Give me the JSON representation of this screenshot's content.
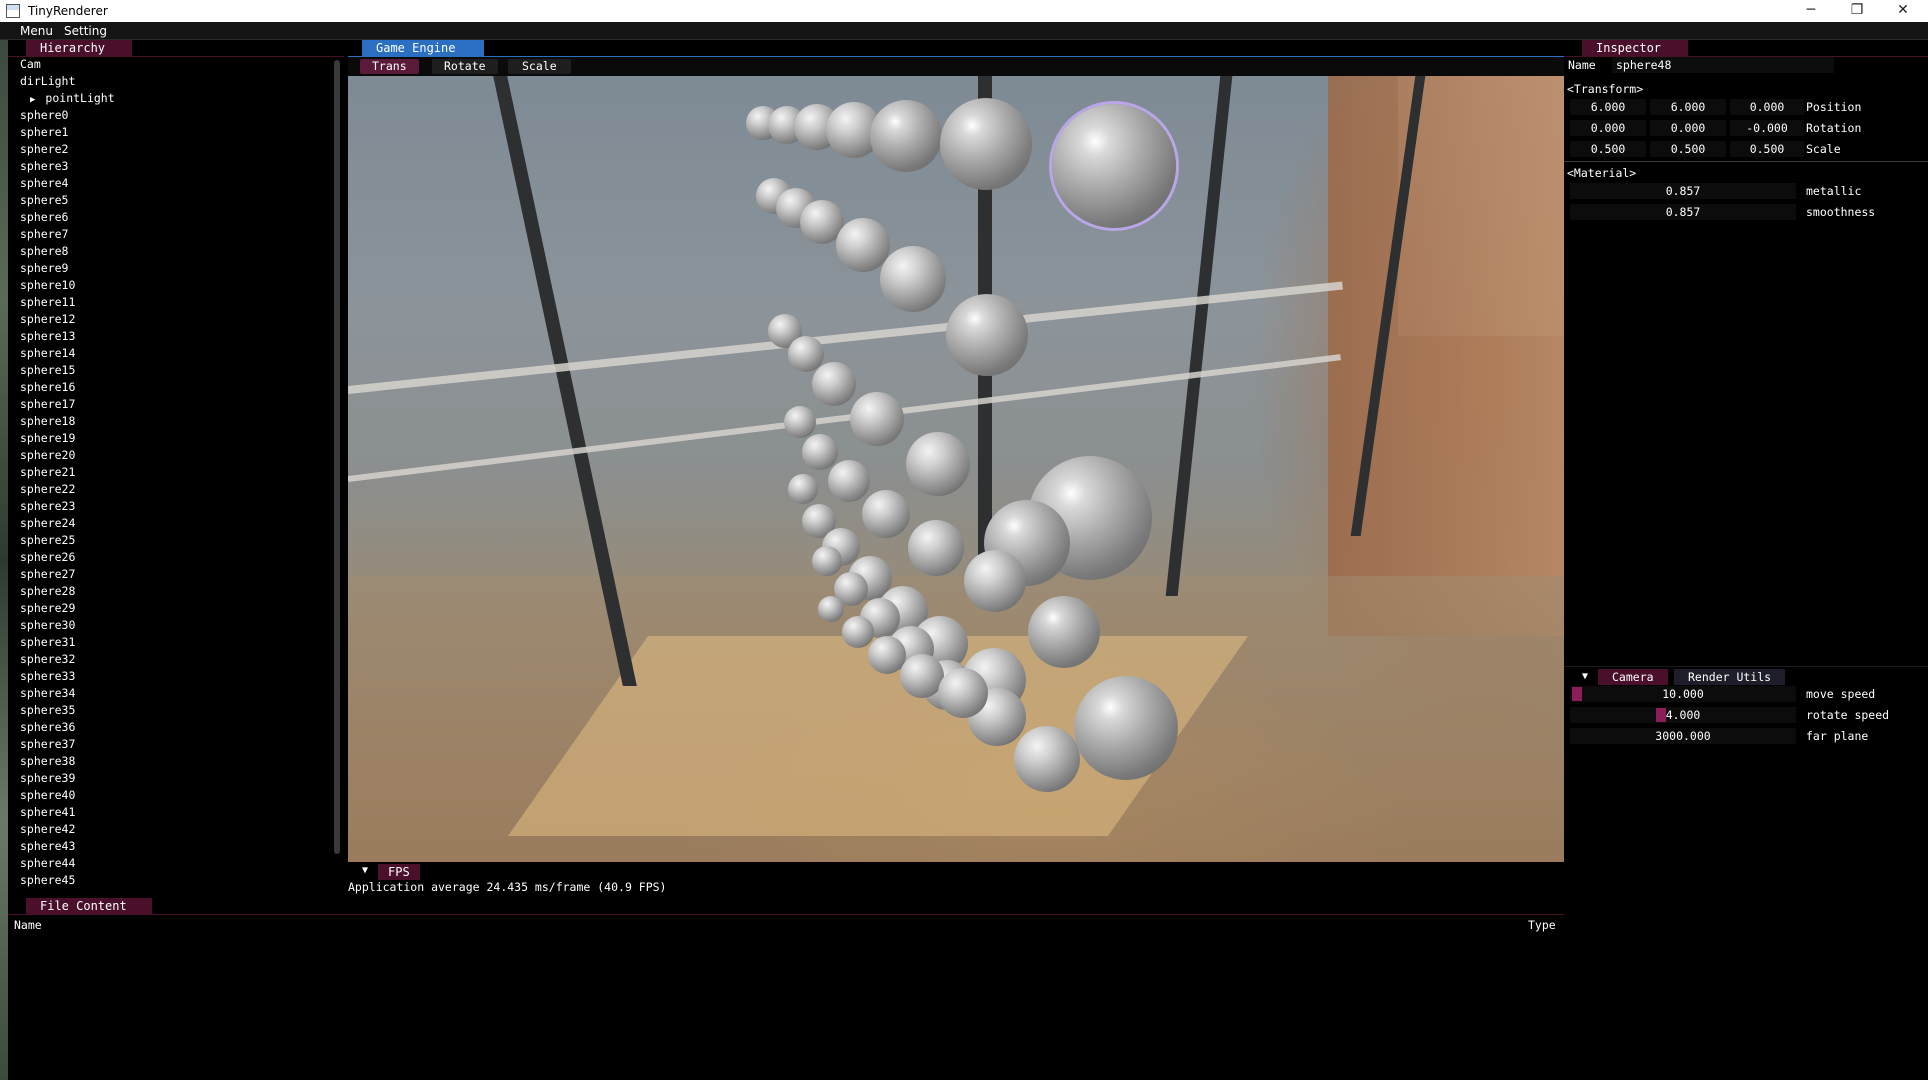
{
  "window": {
    "title": "TinyRenderer",
    "controls": {
      "minimize": "─",
      "maximize": "❐",
      "close": "✕"
    }
  },
  "menubar": {
    "items": [
      "Menu",
      "Setting"
    ]
  },
  "hierarchy": {
    "tab": "Hierarchy",
    "items": [
      "Cam",
      "dirLight",
      "pointLight",
      "sphere0",
      "sphere1",
      "sphere2",
      "sphere3",
      "sphere4",
      "sphere5",
      "sphere6",
      "sphere7",
      "sphere8",
      "sphere9",
      "sphere10",
      "sphere11",
      "sphere12",
      "sphere13",
      "sphere14",
      "sphere15",
      "sphere16",
      "sphere17",
      "sphere18",
      "sphere19",
      "sphere20",
      "sphere21",
      "sphere22",
      "sphere23",
      "sphere24",
      "sphere25",
      "sphere26",
      "sphere27",
      "sphere28",
      "sphere29",
      "sphere30",
      "sphere31",
      "sphere32",
      "sphere33",
      "sphere34",
      "sphere35",
      "sphere36",
      "sphere37",
      "sphere38",
      "sphere39",
      "sphere40",
      "sphere41",
      "sphere42",
      "sphere43",
      "sphere44",
      "sphere45"
    ],
    "expander": "▶"
  },
  "viewport": {
    "tab": "Game Engine",
    "tools": [
      "Trans",
      "Rotate",
      "Scale"
    ]
  },
  "fps": {
    "header": "FPS",
    "collapse": "▼",
    "text": "Application average 24.435 ms/frame (40.9 FPS)"
  },
  "file_content": {
    "tab": "File Content",
    "columns": {
      "name": "Name",
      "type": "Type"
    }
  },
  "inspector": {
    "tab": "Inspector",
    "name_label": "Name",
    "name_value": "sphere48",
    "transform_header": "<Transform>",
    "position": {
      "x": "6.000",
      "y": "6.000",
      "z": "0.000",
      "label": "Position"
    },
    "rotation": {
      "x": "0.000",
      "y": "0.000",
      "z": "-0.000",
      "label": "Rotation"
    },
    "scale": {
      "x": "0.500",
      "y": "0.500",
      "z": "0.500",
      "label": "Scale"
    },
    "material_header": "<Material>",
    "metallic": {
      "value": "0.857",
      "label": "metallic"
    },
    "smoothness": {
      "value": "0.857",
      "label": "smoothness"
    }
  },
  "camera": {
    "collapse": "▼",
    "tabs": [
      "Camera",
      "Render Utils"
    ],
    "move_speed": {
      "value": "10.000",
      "label": "move speed"
    },
    "rotate_speed": {
      "value": "4.000",
      "label": "rotate speed"
    },
    "far_plane": {
      "value": "3000.000",
      "label": "far plane"
    }
  },
  "colors": {
    "panel_tab": "#4a0f2a",
    "active_tab": "#2a6fc2",
    "field_bg": "#0c0c0c",
    "selection_outline": "#b9a6e6"
  }
}
